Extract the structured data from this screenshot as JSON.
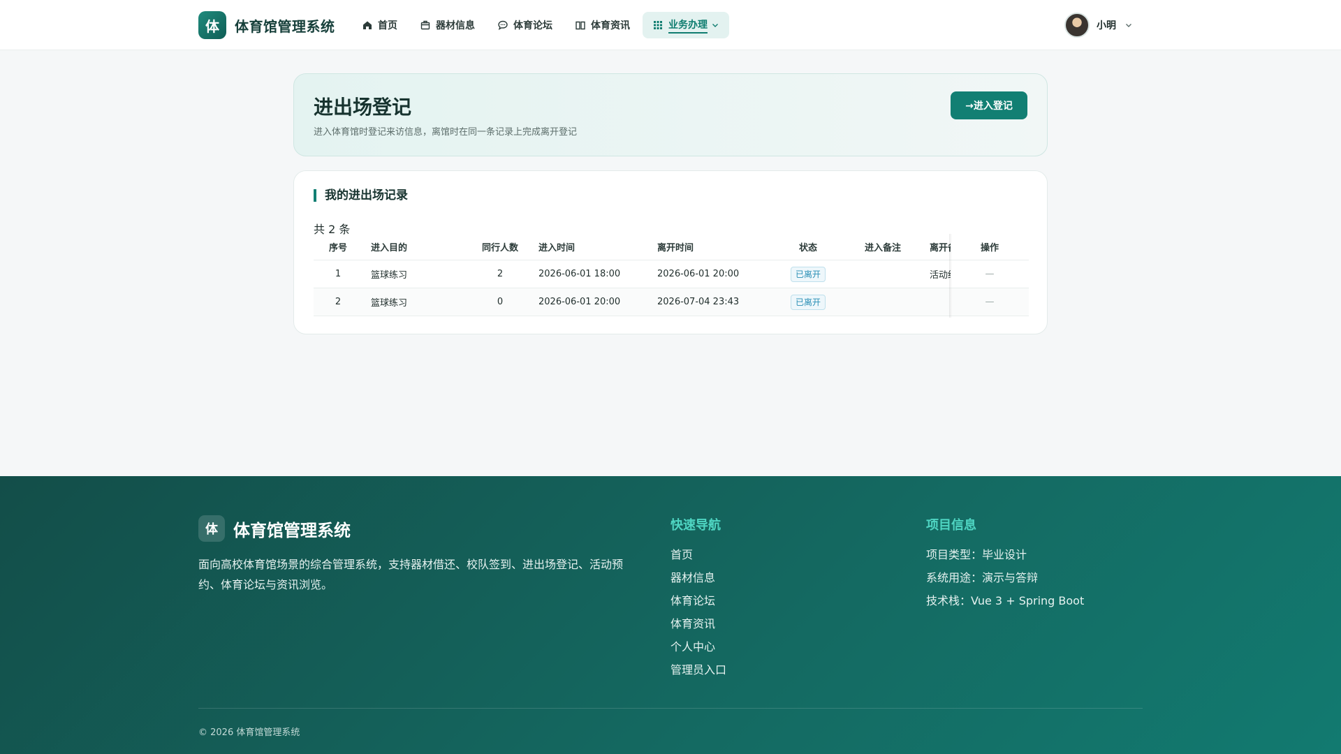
{
  "header": {
    "logo_char": "体",
    "brand": "体育馆管理系统",
    "nav": [
      {
        "label": "首页",
        "icon": "home-icon"
      },
      {
        "label": "器材信息",
        "icon": "box-icon"
      },
      {
        "label": "体育论坛",
        "icon": "chat-icon"
      },
      {
        "label": "体育资讯",
        "icon": "book-icon"
      },
      {
        "label": "业务办理",
        "icon": "grid-icon",
        "active": true
      }
    ],
    "user_name": "小明"
  },
  "hero": {
    "title": "进出场登记",
    "subtitle": "进入体育馆时登记来访信息，离馆时在同一条记录上完成离开登记",
    "button": "→进入登记"
  },
  "records": {
    "title": "我的进出场记录",
    "total": "共 2 条",
    "columns": [
      "序号",
      "进入目的",
      "同行人数",
      "进入时间",
      "离开时间",
      "状态",
      "进入备注",
      "离开备注",
      "操作"
    ],
    "rows": [
      {
        "idx": "1",
        "purpose": "篮球练习",
        "count": "2",
        "in_time": "2026-06-01 18:00",
        "out_time": "2026-06-01 20:00",
        "status": "已离开",
        "in_remark": "",
        "out_remark": "活动结束",
        "op": "—"
      },
      {
        "idx": "2",
        "purpose": "篮球练习",
        "count": "0",
        "in_time": "2026-06-01 20:00",
        "out_time": "2026-07-04 23:43",
        "status": "已离开",
        "in_remark": "",
        "out_remark": "",
        "op": "—"
      }
    ]
  },
  "footer": {
    "logo_char": "体",
    "brand": "体育馆管理系统",
    "description": "面向高校体育馆场景的综合管理系统，支持器材借还、校队签到、进出场登记、活动预约、体育论坛与资讯浏览。",
    "quick_nav_title": "快速导航",
    "quick_nav": [
      "首页",
      "器材信息",
      "体育论坛",
      "体育资讯",
      "个人中心",
      "管理员入口"
    ],
    "project_title": "项目信息",
    "project_info": [
      "项目类型：毕业设计",
      "系统用途：演示与答辩",
      "技术栈：Vue 3 + Spring Boot"
    ],
    "copyright": "© 2026 体育馆管理系统"
  },
  "colors": {
    "primary": "#127f73",
    "footer_bg": "#146a62",
    "footer_accent": "#4fd6c3",
    "status_badge": "#2a8fb5"
  }
}
